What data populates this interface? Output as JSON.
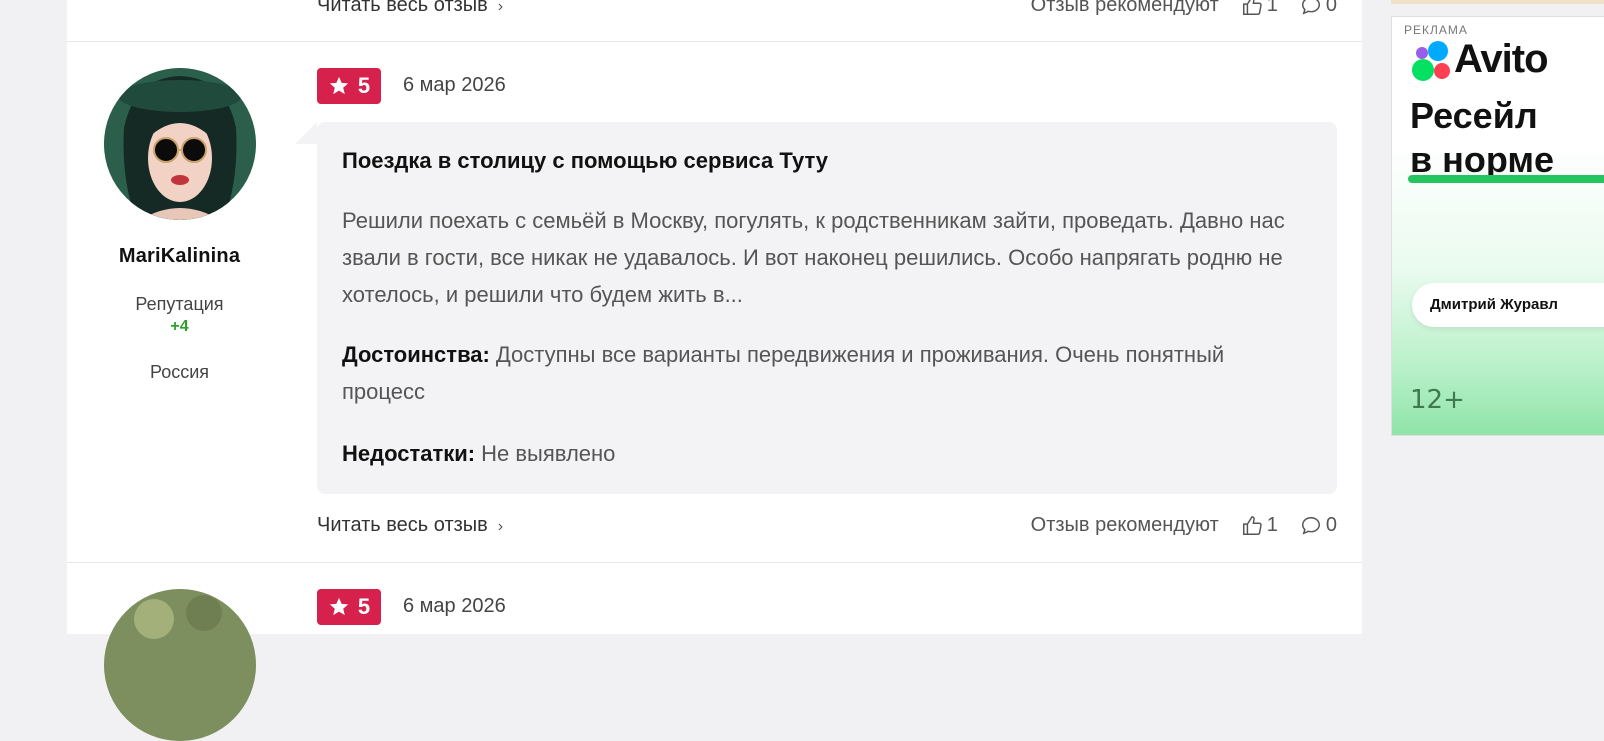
{
  "top_footer": {
    "read_full_label": "Читать весь отзыв",
    "recommend_label": "Отзыв рекомендуют",
    "likes": "1",
    "comments": "0"
  },
  "review": {
    "author": {
      "name": "MariKalinina",
      "reputation_label": "Репутация",
      "reputation_value": "+4",
      "country": "Россия"
    },
    "rating": "5",
    "date": "6 мар 2026",
    "title": "Поездка в столицу с помощью сервиса Туту",
    "text": "Решили поехать с семьёй в Москву, погулять, к родственникам зайти, проведать. Давно нас звали в гости, все никак не удавалось. И вот наконец решились. Особо напрягать родню не хотелось, и решили что будем жить в...",
    "pros_label": "Достоинства:",
    "pros": "Доступны все варианты передвижения и проживания. Очень понятный процесс",
    "cons_label": "Недостатки:",
    "cons": "Не выявлено",
    "read_full_label": "Читать весь отзыв",
    "recommend_label": "Отзыв рекомендуют",
    "likes": "1",
    "comments": "0"
  },
  "next_review": {
    "rating": "5",
    "date": "6 мар 2026"
  },
  "ad": {
    "label": "РЕКЛАМА",
    "brand": "Avito",
    "headline_line1": "Ресейл",
    "headline_line2": "в норме",
    "chip_text": "Дмитрий Журавл",
    "age_rating": "12+"
  },
  "colors": {
    "rating_badge": "#d6214c",
    "reputation_positive": "#2ca02c",
    "card_background": "#f3f3f5"
  },
  "icons": [
    "star-icon",
    "chevron-right-icon",
    "thumbs-up-icon",
    "comment-icon",
    "avito-logo-icon"
  ]
}
